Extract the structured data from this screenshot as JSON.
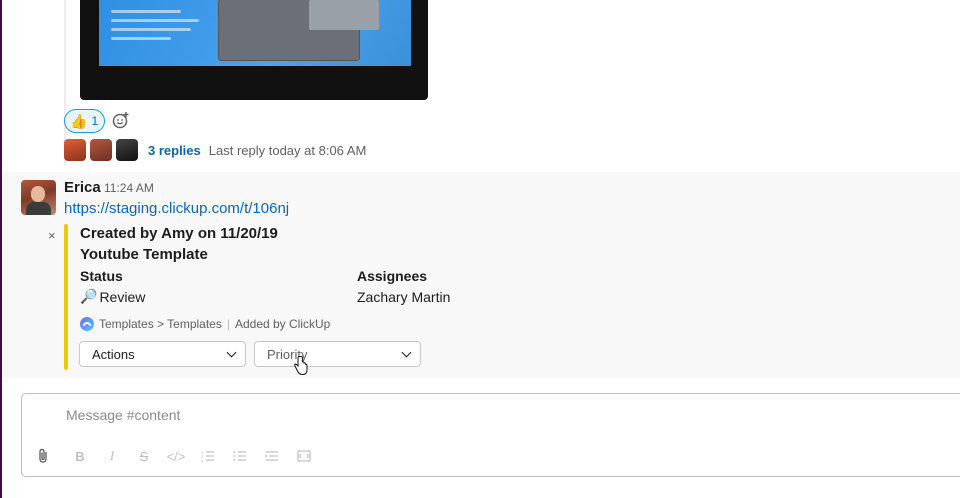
{
  "previous_message": {
    "reaction": {
      "emoji": "👍",
      "count": "1"
    },
    "add_reaction_icon": "add-emoji-icon",
    "thread": {
      "replies": "3 replies",
      "last_reply": "Last reply today at 8:06 AM"
    }
  },
  "message": {
    "sender": "Erica",
    "time": "11:24 AM",
    "link": "https://staging.clickup.com/t/106nj",
    "unfurl": {
      "accent_color": "#f2c80f",
      "title": "Created by Amy on 11/20/19",
      "subtitle": "Youtube Template",
      "status_label": "Status",
      "status_icon": "🔎",
      "status_value": "Review",
      "assignees_label": "Assignees",
      "assignees_value": "Zachary Martin",
      "breadcrumb": "Templates > Templates",
      "added_by": "Added by ClickUp",
      "actions_select": "Actions",
      "priority_select": "Priority",
      "close_icon": "×"
    }
  },
  "composer": {
    "placeholder": "Message #content",
    "toolbar": [
      "attach-icon",
      "bold-icon",
      "italic-icon",
      "strikethrough-icon",
      "code-icon",
      "ordered-list-icon",
      "bulleted-list-icon",
      "blockquote-icon",
      "code-block-icon"
    ]
  }
}
